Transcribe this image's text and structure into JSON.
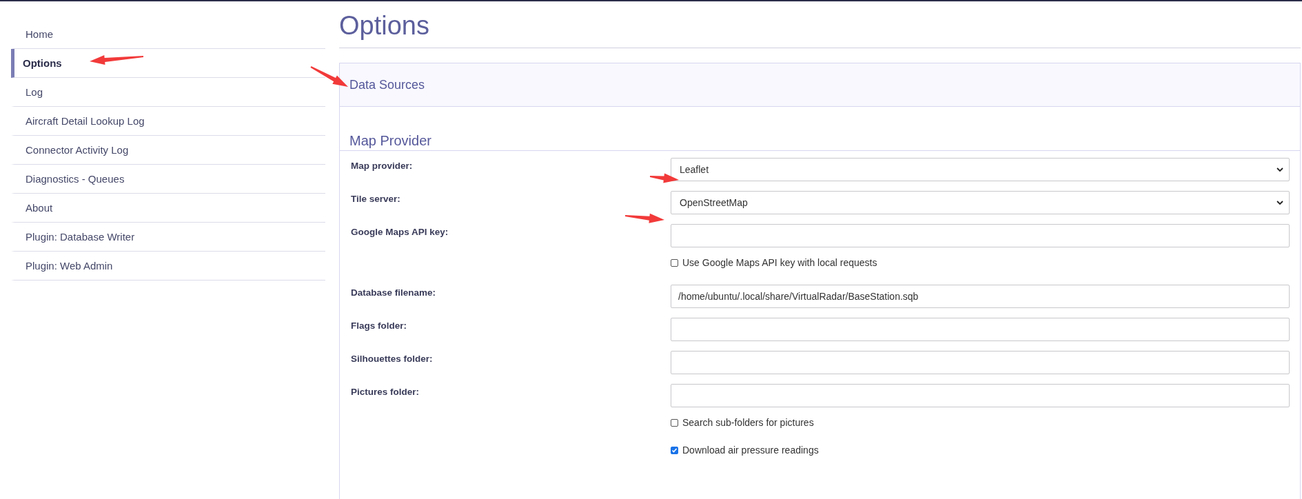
{
  "sidebar": {
    "items": [
      {
        "label": "Home",
        "selected": false
      },
      {
        "label": "Options",
        "selected": true
      },
      {
        "label": "Log",
        "selected": false
      },
      {
        "label": "Aircraft Detail Lookup Log",
        "selected": false
      },
      {
        "label": "Connector Activity Log",
        "selected": false
      },
      {
        "label": "Diagnostics - Queues",
        "selected": false
      },
      {
        "label": "About",
        "selected": false
      },
      {
        "label": "Plugin: Database Writer",
        "selected": false
      },
      {
        "label": "Plugin: Web Admin",
        "selected": false
      }
    ]
  },
  "page": {
    "title": "Options"
  },
  "panel": {
    "title": "Data Sources",
    "section": "Map Provider",
    "rows": [
      {
        "kind": "select",
        "label": "Map provider:",
        "value": "Leaflet"
      },
      {
        "kind": "select",
        "label": "Tile server:",
        "value": "OpenStreetMap"
      },
      {
        "kind": "text",
        "label": "Google Maps API key:"
      },
      {
        "kind": "checkbox",
        "text": "Use Google Maps API key with local requests",
        "checked": false
      },
      {
        "kind": "text",
        "label": "Database filename:",
        "value": "/home/ubuntu/.local/share/VirtualRadar/BaseStation.sqb"
      },
      {
        "kind": "text",
        "label": "Flags folder:"
      },
      {
        "kind": "text",
        "label": "Silhouettes folder:"
      },
      {
        "kind": "text",
        "label": "Pictures folder:"
      },
      {
        "kind": "checkbox",
        "text": "Search sub-folders for pictures",
        "checked": false
      },
      {
        "kind": "checkbox",
        "text": "Download air pressure readings",
        "checked": true
      }
    ]
  }
}
